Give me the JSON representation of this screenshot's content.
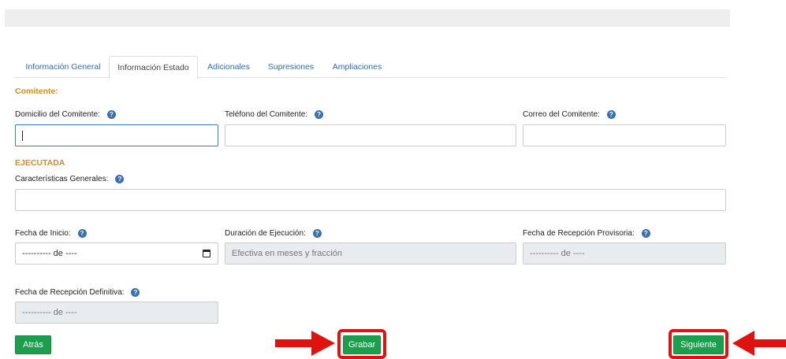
{
  "tabs": [
    {
      "label": "Información General"
    },
    {
      "label": "Información Estado"
    },
    {
      "label": "Adicionales"
    },
    {
      "label": "Supresiones"
    },
    {
      "label": "Ampliaciones"
    }
  ],
  "comitente": {
    "section_title": "Comitente:",
    "domicilio_label": "Domicilio del Comitente:",
    "telefono_label": "Teléfono del Comitente:",
    "correo_label": "Correo del Comitente:"
  },
  "ejecutada": {
    "section_title": "EJECUTADA",
    "caracteristicas_label": "Características Generales:",
    "fecha_inicio_label": "Fecha de Inicio:",
    "fecha_inicio_value": "---------- de ----",
    "duracion_label": "Duración de Ejecución:",
    "duracion_placeholder": "Efectiva en meses y fracción",
    "recepcion_provisoria_label": "Fecha de Recepción Provisoria:",
    "recepcion_provisoria_value": "---------- de ----",
    "recepcion_definitiva_label": "Fecha de Recepción Definitiva:",
    "recepcion_definitiva_value": "---------- de ----"
  },
  "help_glyph": "?",
  "buttons": {
    "atras": "Atrás",
    "grabar": "Grabar",
    "siguiente": "Siguiente"
  },
  "colors": {
    "section_orange": "#e08a1e",
    "tab_blue": "#2a6ebb",
    "button_green": "#1c9e4c",
    "highlight_red": "#e0120f"
  }
}
